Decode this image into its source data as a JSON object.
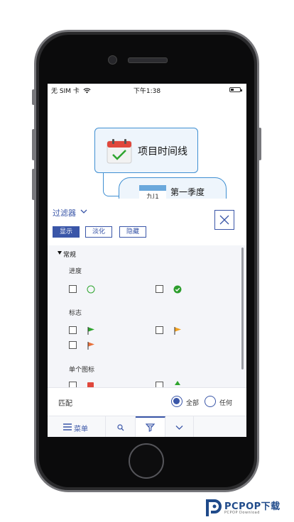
{
  "status_bar": {
    "carrier": "无 SIM 卡",
    "time": "下午1:38"
  },
  "canvas": {
    "main_topic": "项目时间线",
    "sub_topic": "第一季度",
    "sub_topic_icon_text": "九|1"
  },
  "filter": {
    "title": "过滤器",
    "modes": [
      "显示",
      "淡化",
      "隐藏"
    ],
    "active_mode": "显示",
    "section": "常规",
    "groups": {
      "progress": "进度",
      "flags": "标志",
      "single_icon": "单个图标"
    },
    "match": {
      "label": "匹配",
      "all": "全部",
      "any": "任何",
      "selected": "全部"
    }
  },
  "toolbar": {
    "menu_label": "菜单"
  },
  "colors": {
    "accent": "#3a56a8",
    "node_border": "#3f8fd2",
    "check_green": "#2e9e2e",
    "flag_green": "#2fa52f",
    "flag_orange": "#f0a020",
    "flag_red_orange": "#e8703a",
    "calendar_red": "#e0473c"
  },
  "watermark": {
    "brand": "PCPOP下载",
    "sub": "PCPOP Download"
  }
}
